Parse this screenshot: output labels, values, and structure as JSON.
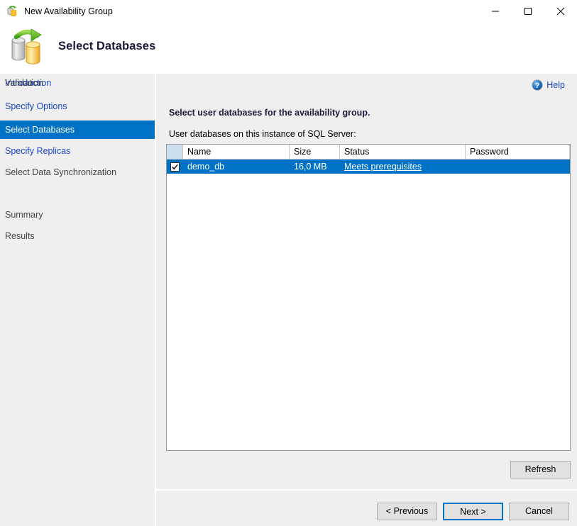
{
  "window": {
    "title": "New Availability Group",
    "icon": "availability-group-icon",
    "controls": {
      "minimize": "minimize-icon",
      "maximize": "maximize-icon",
      "close": "close-icon"
    }
  },
  "header": {
    "title": "Select Databases",
    "icon": "databases-sync-icon"
  },
  "sidebar": {
    "items": [
      {
        "label": "Introduction",
        "state": "link"
      },
      {
        "label": "Specify Options",
        "state": "link"
      },
      {
        "label": "Select Databases",
        "state": "active"
      },
      {
        "label": "Specify Replicas",
        "state": "link"
      },
      {
        "label": "Select Data Synchronization",
        "state": "muted"
      },
      {
        "label": "Validation",
        "state": "muted"
      },
      {
        "label": "Summary",
        "state": "muted"
      },
      {
        "label": "Results",
        "state": "muted"
      }
    ]
  },
  "content": {
    "help_label": "Help",
    "help_icon": "help-circle-icon",
    "instruction": "Select user databases for the availability group.",
    "sublabel": "User databases on this instance of SQL Server:",
    "grid": {
      "columns": [
        "",
        "Name",
        "Size",
        "Status",
        "Password"
      ],
      "rows": [
        {
          "checked": true,
          "name": "demo_db",
          "size": "16,0 MB",
          "status": "Meets prerequisites",
          "password": ""
        }
      ]
    },
    "refresh_label": "Refresh"
  },
  "footer": {
    "previous_label": "< Previous",
    "next_label": "Next >",
    "cancel_label": "Cancel"
  },
  "colors": {
    "accent": "#0072c6",
    "link": "#1a46c8",
    "sidebar_bg": "#efefef",
    "header_check_bg": "#cde0f2"
  }
}
